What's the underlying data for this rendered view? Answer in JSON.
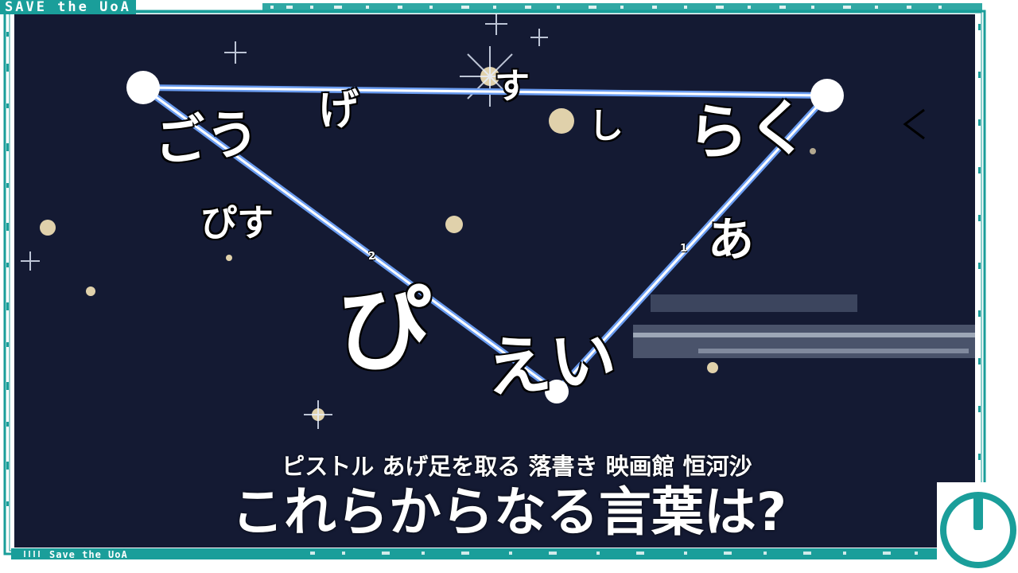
{
  "header": {
    "brand": "SAVE the UoA"
  },
  "footer": {
    "brand": "Save the UoA"
  },
  "puzzle": {
    "words": {
      "gouge": "ごう",
      "ge": "げ",
      "su": "す",
      "shi": "し",
      "raku": "らく",
      "pisu": "ぴす",
      "a": "あ",
      "pi": "ぴ",
      "ei": "えい"
    },
    "vertex_numbers": {
      "n1": "1",
      "n2": "2"
    },
    "hint": "ピストル あげ足を取る 落書き 映画館 恒河沙",
    "question": "これらからなる言葉は?"
  },
  "colors": {
    "accent": "#1a9e9a",
    "board": "#141a33",
    "line": "#7fb0ff",
    "text": "#ffffff"
  },
  "icons": {
    "back": "chevron-left-icon",
    "power": "power-icon"
  }
}
